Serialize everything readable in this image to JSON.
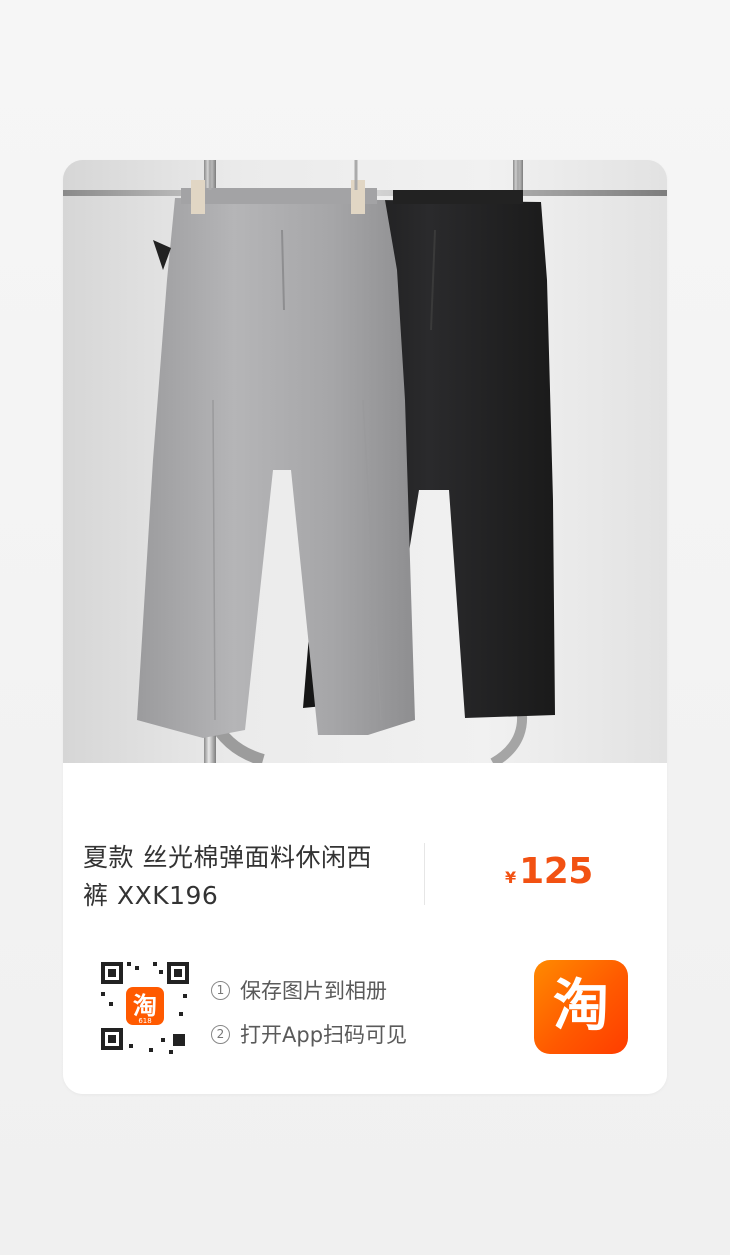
{
  "product": {
    "title_line1": "夏款 丝光棉弹面料休闲西",
    "title_line2": "裤 XXK196",
    "price_symbol": "¥",
    "price_value": "125",
    "price_color": "#f25112"
  },
  "share": {
    "step1_num": "1",
    "step1_text": "保存图片到相册",
    "step2_num": "2",
    "step2_text": "打开App扫码可见",
    "qr_center_logo_text": "淘",
    "qr_center_badge": "618"
  },
  "app_logo": {
    "text": "淘",
    "name": "taobao-logo"
  },
  "image": {
    "subject": "grey-and-black-trousers-on-rack"
  }
}
